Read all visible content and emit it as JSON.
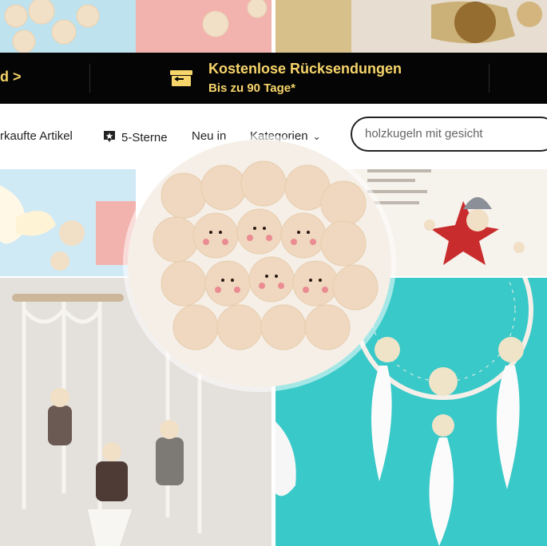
{
  "banner": {
    "left_link": "d",
    "left_chevron": ">",
    "title": "Kostenlose Rücksendungen",
    "subtitle": "Bis zu 90 Tage*",
    "background": "#050505",
    "accent": "#f7d56b"
  },
  "nav": {
    "items": [
      {
        "label": "rkaufte Artikel"
      },
      {
        "label": "5-Sterne",
        "icon": "star-badge-icon"
      },
      {
        "label": "Neu in"
      },
      {
        "label": "Kategorien",
        "icon": "chevron-down-icon"
      }
    ],
    "search": {
      "value": "holzkugeln mit gesicht"
    }
  },
  "images": {
    "top_left": "wooden beads with faces on blue",
    "top_right": "pinecone and ornaments",
    "center": "wooden face beads closeup",
    "bottom_left": "macrame dolls",
    "bottom_right": "dream catcher with face beads",
    "right_top": "red star doll",
    "left_top": "face beads and flowers"
  },
  "colors": {
    "banner_text": "#f7d56b",
    "nav_text": "#222222"
  }
}
